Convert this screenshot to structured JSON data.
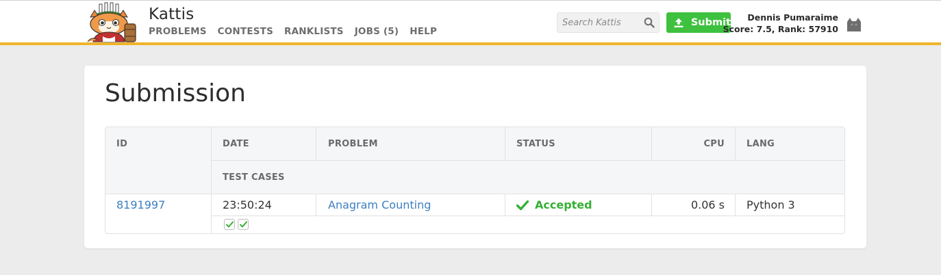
{
  "brand": {
    "title": "Kattis"
  },
  "nav": [
    "PROBLEMS",
    "CONTESTS",
    "RANKLISTS",
    "JOBS (5)",
    "HELP"
  ],
  "search": {
    "placeholder": "Search Kattis"
  },
  "submit": {
    "label": "Submit"
  },
  "user": {
    "name": "Dennis Pumaraime",
    "score": "Score: 7.5, Rank: 57910"
  },
  "page": {
    "title": "Submission"
  },
  "table": {
    "headers": {
      "id": "ID",
      "date": "DATE",
      "problem": "PROBLEM",
      "status": "STATUS",
      "cpu": "CPU",
      "lang": "LANG",
      "test_cases": "TEST CASES"
    },
    "row": {
      "id": "8191997",
      "date": "23:50:24",
      "problem": "Anagram Counting",
      "status": "Accepted",
      "cpu": "0.06 s",
      "lang": "Python 3",
      "test_cases_passed": 2
    }
  },
  "colors": {
    "accent_bar": "#f0b429",
    "submit_green": "#3ec13e",
    "link_blue": "#3d7fc2",
    "accepted_green": "#35b035"
  },
  "icons": {
    "logo": "kattis-cat-logo",
    "search": "magnifier-icon",
    "submit": "upload-icon",
    "avatar": "user-avatar-icon",
    "status": "checkmark-icon",
    "test_case": "checkbox-check-icon"
  }
}
